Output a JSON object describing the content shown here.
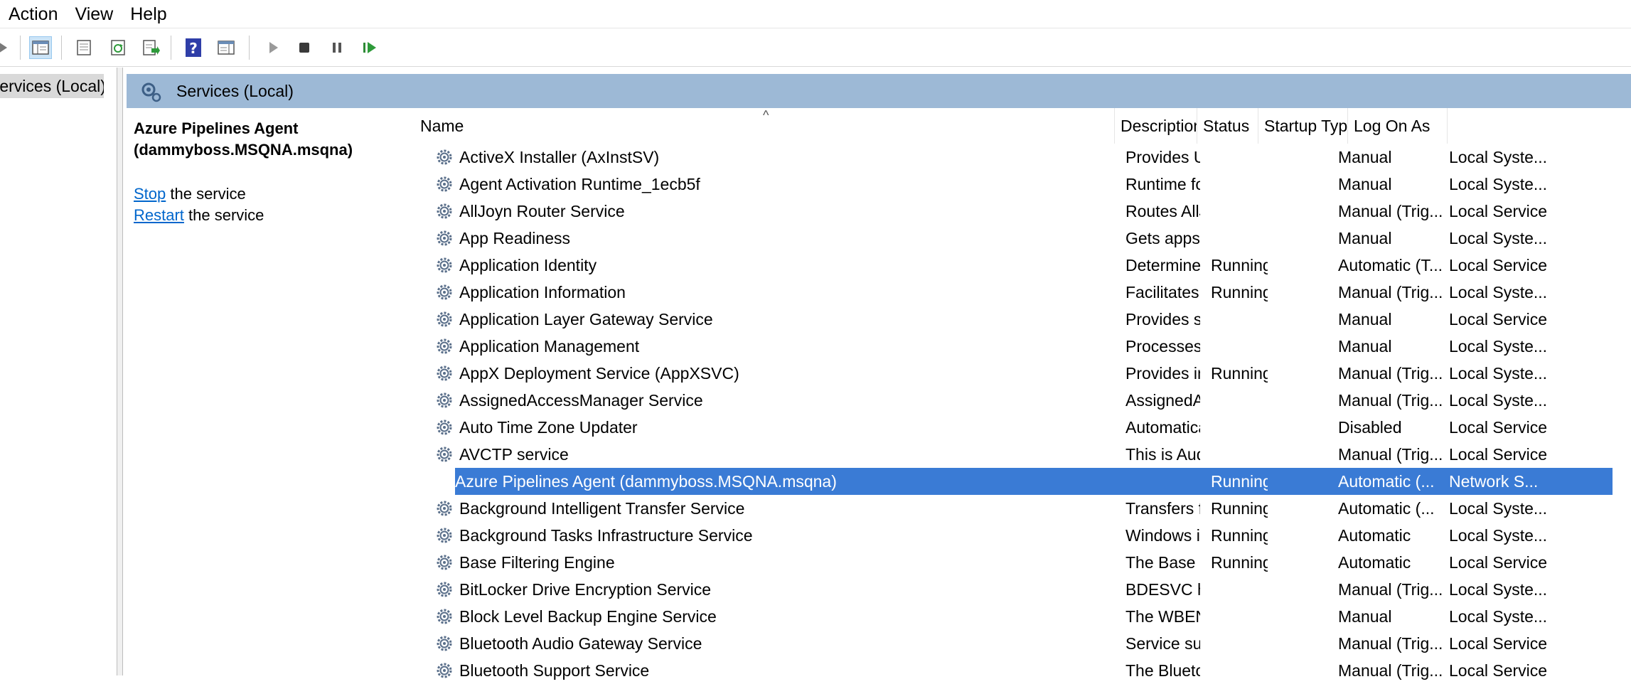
{
  "menu": [
    "Action",
    "View",
    "Help"
  ],
  "tree": {
    "node_label": "Services (Local)"
  },
  "banner": {
    "title": "Services (Local)"
  },
  "details": {
    "service_title": "Azure Pipelines Agent (dammyboss.MSQNA.msqna)",
    "stop_link": "Stop",
    "stop_rest": " the service",
    "restart_link": "Restart",
    "restart_rest": " the service"
  },
  "columns": {
    "name": "Name",
    "description": "Description",
    "status": "Status",
    "startup": "Startup Type",
    "logon": "Log On As"
  },
  "rows": [
    {
      "name": "ActiveX Installer (AxInstSV)",
      "description": "Provides Us...",
      "status": "",
      "startup": "Manual",
      "logon": "Local Syste..."
    },
    {
      "name": "Agent Activation Runtime_1ecb5f",
      "description": "Runtime for...",
      "status": "",
      "startup": "Manual",
      "logon": "Local Syste..."
    },
    {
      "name": "AllJoyn Router Service",
      "description": "Routes AllJo...",
      "status": "",
      "startup": "Manual (Trig...",
      "logon": "Local Service"
    },
    {
      "name": "App Readiness",
      "description": "Gets apps re...",
      "status": "",
      "startup": "Manual",
      "logon": "Local Syste..."
    },
    {
      "name": "Application Identity",
      "description": "Determines ...",
      "status": "Running",
      "startup": "Automatic (T...",
      "logon": "Local Service"
    },
    {
      "name": "Application Information",
      "description": "Facilitates t...",
      "status": "Running",
      "startup": "Manual (Trig...",
      "logon": "Local Syste..."
    },
    {
      "name": "Application Layer Gateway Service",
      "description": "Provides su...",
      "status": "",
      "startup": "Manual",
      "logon": "Local Service"
    },
    {
      "name": "Application Management",
      "description": "Processes in...",
      "status": "",
      "startup": "Manual",
      "logon": "Local Syste..."
    },
    {
      "name": "AppX Deployment Service (AppXSVC)",
      "description": "Provides inf...",
      "status": "Running",
      "startup": "Manual (Trig...",
      "logon": "Local Syste..."
    },
    {
      "name": "AssignedAccessManager Service",
      "description": "AssignedAc...",
      "status": "",
      "startup": "Manual (Trig...",
      "logon": "Local Syste..."
    },
    {
      "name": "Auto Time Zone Updater",
      "description": "Automatica...",
      "status": "",
      "startup": "Disabled",
      "logon": "Local Service"
    },
    {
      "name": "AVCTP service",
      "description": "This is Audi...",
      "status": "",
      "startup": "Manual (Trig...",
      "logon": "Local Service"
    },
    {
      "name": "Azure Pipelines Agent (dammyboss.MSQNA.msqna)",
      "description": "",
      "status": "Running",
      "startup": "Automatic (...",
      "logon": "Network S...",
      "selected": true
    },
    {
      "name": "Background Intelligent Transfer Service",
      "description": "Transfers fil...",
      "status": "Running",
      "startup": "Automatic (...",
      "logon": "Local Syste..."
    },
    {
      "name": "Background Tasks Infrastructure Service",
      "description": "Windows in...",
      "status": "Running",
      "startup": "Automatic",
      "logon": "Local Syste..."
    },
    {
      "name": "Base Filtering Engine",
      "description": "The Base Fil...",
      "status": "Running",
      "startup": "Automatic",
      "logon": "Local Service"
    },
    {
      "name": "BitLocker Drive Encryption Service",
      "description": "BDESVC hos...",
      "status": "",
      "startup": "Manual (Trig...",
      "logon": "Local Syste..."
    },
    {
      "name": "Block Level Backup Engine Service",
      "description": "The WBENG...",
      "status": "",
      "startup": "Manual",
      "logon": "Local Syste..."
    },
    {
      "name": "Bluetooth Audio Gateway Service",
      "description": "Service sup...",
      "status": "",
      "startup": "Manual (Trig...",
      "logon": "Local Service"
    },
    {
      "name": "Bluetooth Support Service",
      "description": "The Bluetoo...",
      "status": "",
      "startup": "Manual (Trig...",
      "logon": "Local Service"
    }
  ]
}
